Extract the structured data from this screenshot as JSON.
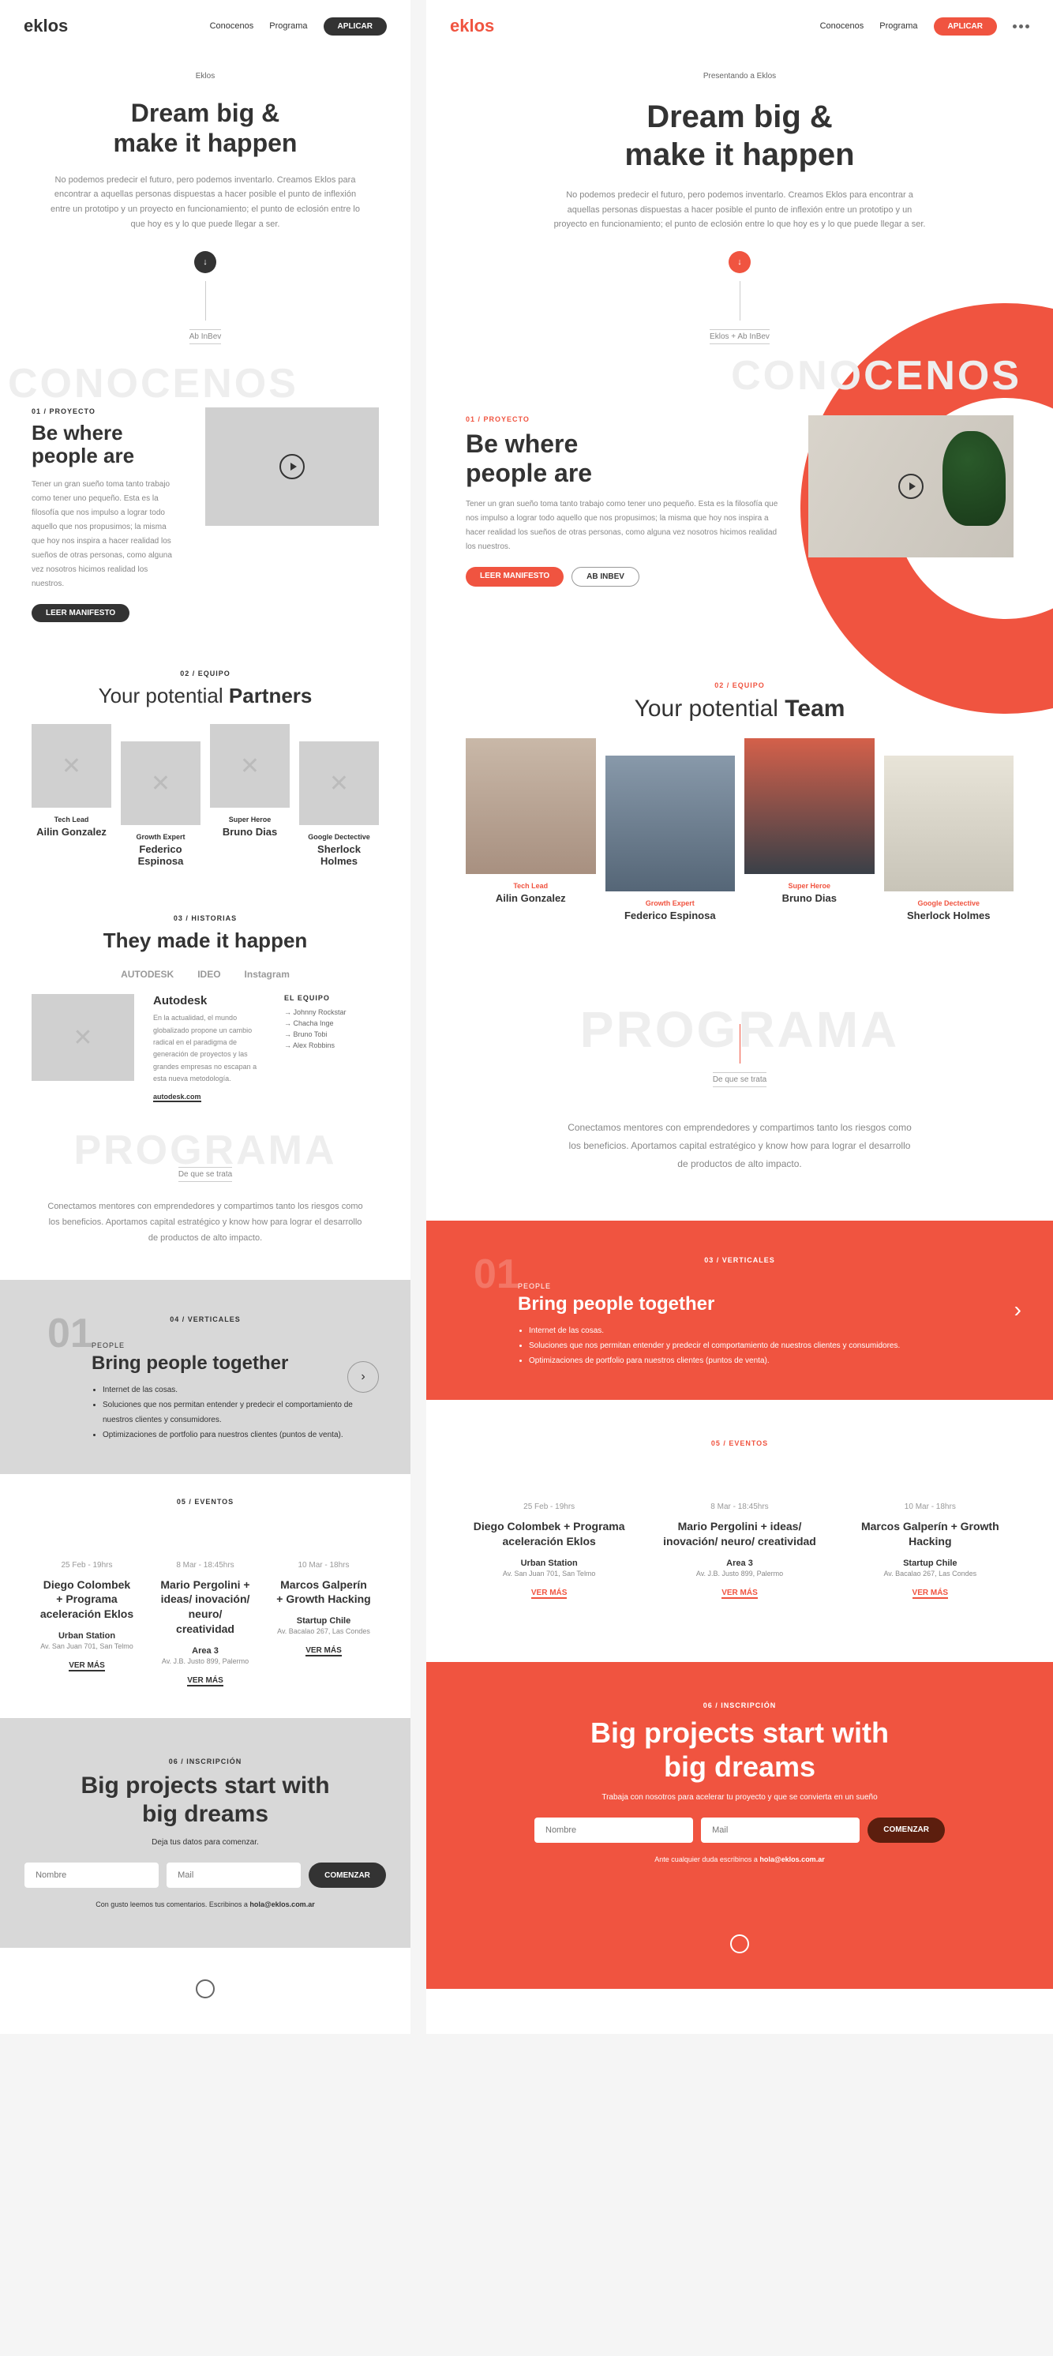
{
  "nav": {
    "logo": "eklos",
    "links": [
      "Conocenos",
      "Programa"
    ],
    "apply": "APLICAR"
  },
  "hero": {
    "bracket_left": "Eklos",
    "bracket_right": "Presentando a Eklos",
    "title_l1": "Dream big &",
    "title_l2": "make it happen",
    "desc": "No podemos predecir el futuro, pero podemos inventarlo. Creamos Eklos para encontrar a aquellas personas dispuestas a hacer posible el punto de inflexión entre un prototipo y un proyecto en funcionamiento; el punto de eclosión entre lo que hoy es y lo que puede llegar a ser.",
    "arrow": "↓"
  },
  "conocenos_wm": "CONOCENOS",
  "mini_ab": "Ab InBev",
  "mini_ab_full": "Eklos + Ab InBev",
  "s1": {
    "eyebrow": "01 / PROYECTO",
    "title_l1": "Be where",
    "title_l2": "people are",
    "desc": "Tener un gran sueño toma tanto trabajo como tener uno pequeño. Esta es la filosofía que nos impulso a lograr todo aquello que nos propusimos; la misma que hoy nos inspira a hacer realidad los sueños de otras personas, como alguna vez nosotros hicimos realidad los nuestros.",
    "btn1": "LEER MANIFESTO",
    "btn2": "AB INBEV"
  },
  "s2": {
    "eyebrow": "02 / EQUIPO",
    "title_left": "Your potential Partners",
    "title_right": "Your potential Team",
    "members": [
      {
        "role": "Tech Lead",
        "name": "Ailin Gonzalez"
      },
      {
        "role": "Growth Expert",
        "name": "Federico Espinosa"
      },
      {
        "role": "Super Heroe",
        "name": "Bruno Dias"
      },
      {
        "role": "Google Dectective",
        "name": "Sherlock Holmes"
      }
    ]
  },
  "s3": {
    "eyebrow": "03 / HISTORIAS",
    "title": "They made it happen",
    "brands": [
      "AUTODESK",
      "IDEO",
      "Instagram"
    ],
    "story_title": "Autodesk",
    "story_desc": "En la actualidad, el mundo globalizado propone un cambio radical en el paradigma de generación de proyectos y las grandes empresas no escapan a esta nueva metodología.",
    "story_link": "autodesk.com",
    "equipo_label": "EL EQUIPO",
    "equipo": [
      "Johnny Rockstar",
      "Chacha Inge",
      "Bruno Tobi",
      "Alex Robbins"
    ]
  },
  "programa_wm": "PROGRAMA",
  "prog_label": "De que se trata",
  "prog_desc": "Conectamos mentores con emprendedores y compartimos tanto los riesgos como los beneficios. Aportamos capital estratégico y know how para lograr el desarrollo de productos de alto impacto.",
  "s4": {
    "eyebrow_left": "04 / VERTICALES",
    "eyebrow_right": "03 / VERTICALES",
    "num": "01",
    "label": "PEOPLE",
    "title": "Bring people together",
    "items": [
      "Internet de las cosas.",
      "Soluciones que nos permitan entender y predecir el comportamiento de nuestros clientes y consumidores.",
      "Optimizaciones de portfolio para nuestros clientes (puntos de venta)."
    ]
  },
  "s5": {
    "eyebrow": "05 / EVENTOS",
    "events": [
      {
        "date": "25 Feb - 19hrs",
        "title": "Diego Colombek + Programa aceleración Eklos",
        "venue": "Urban Station",
        "addr": "Av. San Juan 701, San Telmo"
      },
      {
        "date": "8 Mar - 18:45hrs",
        "title": "Mario Pergolini + ideas/ inovación/ neuro/ creatividad",
        "venue": "Area 3",
        "addr": "Av. J.B. Justo 899, Palermo"
      },
      {
        "date": "10 Mar - 18hrs",
        "title": "Marcos Galperín + Growth Hacking",
        "venue": "Startup Chile",
        "addr": "Av. Bacalao 267, Las Condes"
      }
    ],
    "more": "VER MÁS"
  },
  "s6": {
    "eyebrow": "06 / INSCRIPCIÓN",
    "title_l1": "Big projects start with",
    "title_l2": "big dreams",
    "sub_left": "Deja tus datos para comenzar.",
    "sub_right": "Trabaja con nosotros para acelerar tu proyecto y que se convierta en un sueño",
    "ph_name": "Nombre",
    "ph_mail": "Mail",
    "btn": "COMENZAR",
    "note_pre": "Ante cualquier duda escribinos a ",
    "note_mail": "hola@eklos.com.ar",
    "note_left_pre": "Con gusto leemos tus comentarios. Escribinos a ",
    "note_left_mail": "hola@eklos.com.ar"
  }
}
